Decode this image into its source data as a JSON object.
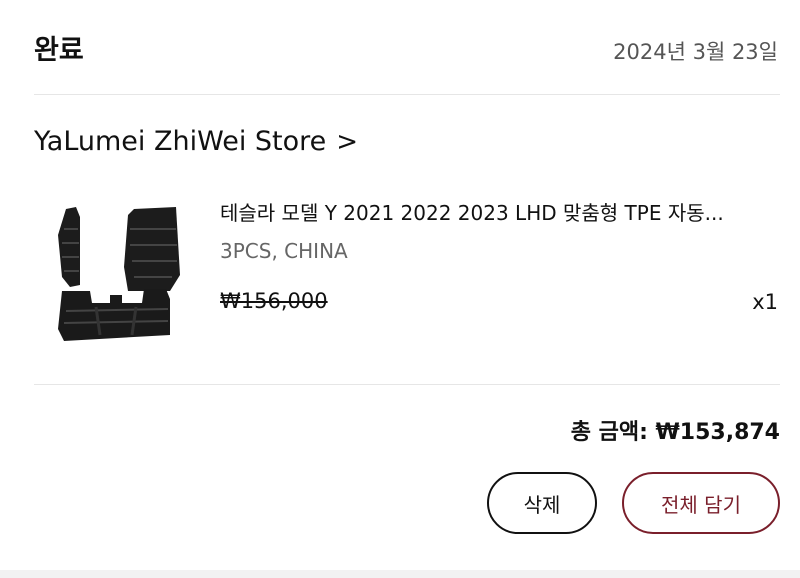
{
  "order": {
    "status": "완료",
    "date": "2024년 3월 23일"
  },
  "store": {
    "name": "YaLumei ZhiWei Store",
    "chevron": ">"
  },
  "item": {
    "image_icon": "car-floor-mat-image",
    "title": "테슬라 모델 Y 2021 2022 2023 LHD 맞춤형 TPE 자동...",
    "variant": "3PCS, CHINA",
    "price": "₩156,000",
    "quantity": "x1"
  },
  "summary": {
    "total": "총 금액: ₩153,874"
  },
  "actions": {
    "delete_label": "삭제",
    "add_all_label": "전체 담기"
  },
  "colors": {
    "accent": "#7a1f2b",
    "text": "#111111",
    "muted": "#666666"
  }
}
